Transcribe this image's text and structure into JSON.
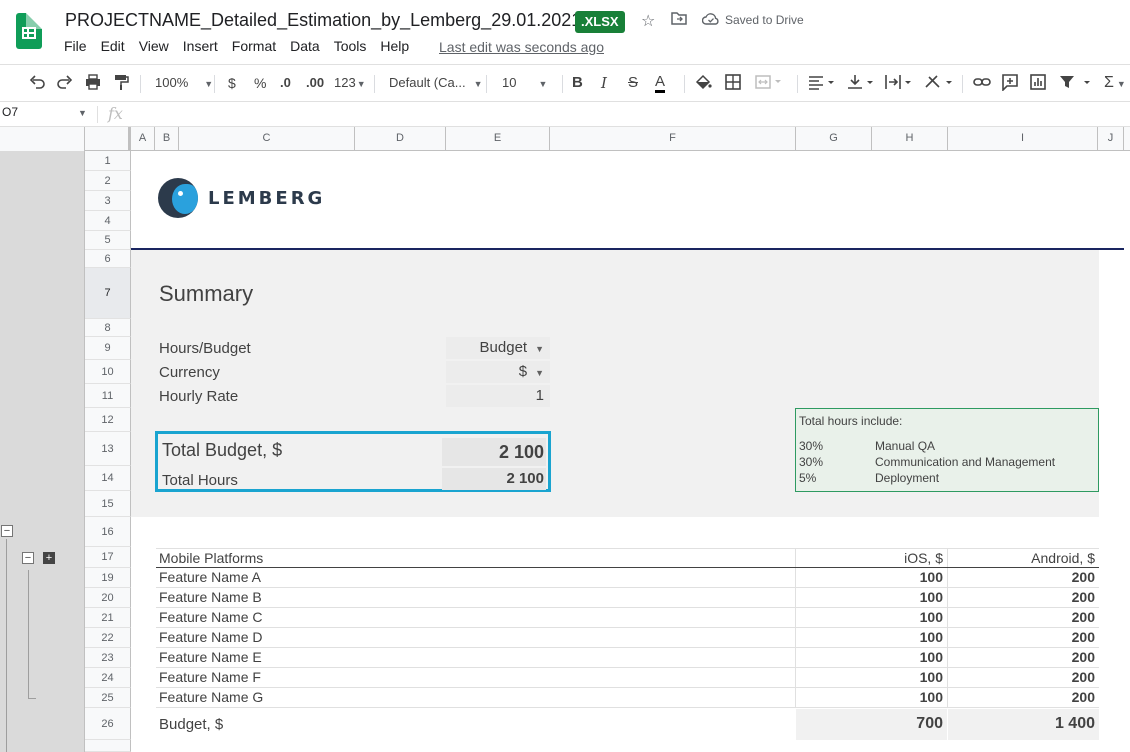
{
  "title": {
    "doc_name": "PROJECTNAME_Detailed_Estimation_by_Lemberg_29.01.2021",
    "badge": ".XLSX",
    "saved": "Saved to Drive",
    "last_edit": "Last edit was seconds ago"
  },
  "menu": [
    "File",
    "Edit",
    "View",
    "Insert",
    "Format",
    "Data",
    "Tools",
    "Help"
  ],
  "toolbar": {
    "zoom": "100%",
    "currency": "$",
    "percent": "%",
    "dec_less": ".0",
    "dec_more": ".00",
    "number_format": "123",
    "font": "Default (Ca...",
    "font_size": "10",
    "bold": "B",
    "italic": "I",
    "strike": "S",
    "text_color": "A",
    "sum": "Σ"
  },
  "formula_bar": {
    "name_box": "O7",
    "fx": "fx"
  },
  "columns": [
    "A",
    "B",
    "C",
    "D",
    "E",
    "F",
    "G",
    "H",
    "I",
    "J"
  ],
  "rows": [
    "1",
    "2",
    "3",
    "4",
    "5",
    "6",
    "7",
    "8",
    "9",
    "10",
    "11",
    "12",
    "13",
    "14",
    "15",
    "16",
    "17",
    "19",
    "20",
    "21",
    "22",
    "23",
    "24",
    "25",
    "26"
  ],
  "logo": {
    "text": "LEMBERG"
  },
  "summary": {
    "title": "Summary",
    "hours_budget_label": "Hours/Budget",
    "hours_budget_value": "Budget",
    "currency_label": "Currency",
    "currency_value": "$",
    "hourly_rate_label": "Hourly Rate",
    "hourly_rate_value": "1",
    "total_budget_label": "Total Budget, $",
    "total_budget_value": "2 100",
    "total_hours_label": "Total Hours",
    "total_hours_value": "2 100"
  },
  "note": {
    "title": "Total hours include:",
    "items": [
      {
        "pct": "30%",
        "label": "Manual QA"
      },
      {
        "pct": "30%",
        "label": "Communication and Management"
      },
      {
        "pct": "5%",
        "label": "Deployment"
      }
    ]
  },
  "platforms": {
    "header": {
      "name": "Mobile Platforms",
      "ios": "iOS, $",
      "android": "Android, $"
    },
    "rows": [
      {
        "name": "Feature Name A",
        "ios": "100",
        "android": "200"
      },
      {
        "name": "Feature Name B",
        "ios": "100",
        "android": "200"
      },
      {
        "name": "Feature Name C",
        "ios": "100",
        "android": "200"
      },
      {
        "name": "Feature Name D",
        "ios": "100",
        "android": "200"
      },
      {
        "name": "Feature Name E",
        "ios": "100",
        "android": "200"
      },
      {
        "name": "Feature Name F",
        "ios": "100",
        "android": "200"
      },
      {
        "name": "Feature Name G",
        "ios": "100",
        "android": "200"
      }
    ],
    "budget": {
      "name": "Budget, $",
      "ios": "700",
      "android": "1 400"
    }
  },
  "colors": {
    "brand_green": "#188038",
    "selection_blue": "#1aa4d0",
    "navy": "#1a2560",
    "note_green": "#2e9a61"
  }
}
